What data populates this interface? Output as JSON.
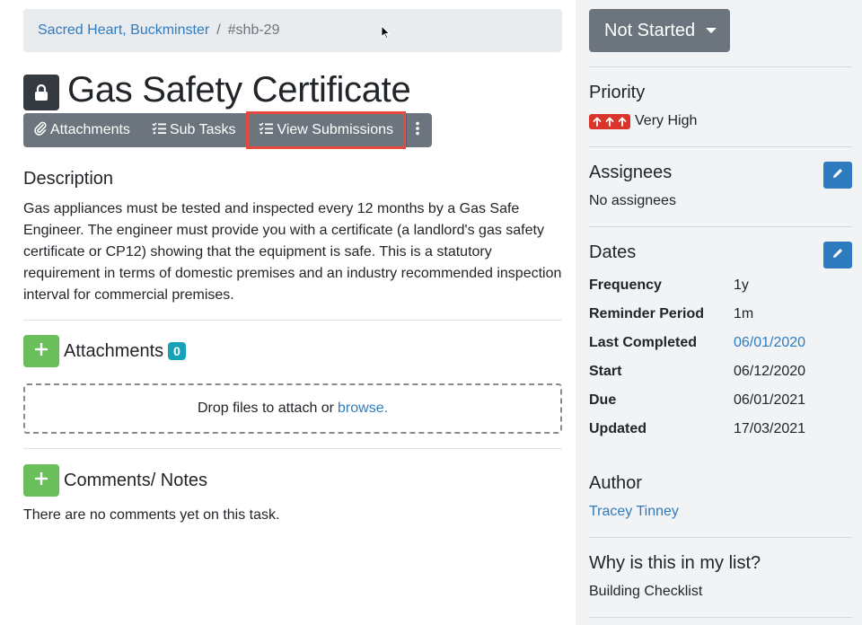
{
  "breadcrumb": {
    "site": "Sacred Heart, Buckminster",
    "separator": "/",
    "ref": "#shb-29"
  },
  "title": "Gas Safety Certificate",
  "toolbar": {
    "attachments_label": "Attachments",
    "subtasks_label": "Sub Tasks",
    "view_submissions_label": "View Submissions"
  },
  "description": {
    "heading": "Description",
    "text": "Gas appliances must be tested and inspected every 12 months by a Gas Safe Engineer. The engineer must provide you with a certificate (a landlord's gas safety certificate or CP12) showing that the equipment is safe. This is a statutory requirement in terms of domestic premises and an industry recommended inspection interval for commercial premises."
  },
  "attachments": {
    "heading": "Attachments",
    "count": "0",
    "drop_text": "Drop files to attach or",
    "browse_link": "browse."
  },
  "comments": {
    "heading": "Comments/ Notes",
    "empty_text": "There are no comments yet on this task."
  },
  "sidebar": {
    "status": "Not Started",
    "priority": {
      "heading": "Priority",
      "value": "Very High",
      "color": "#d9352b"
    },
    "assignees": {
      "heading": "Assignees",
      "value": "No assignees"
    },
    "dates": {
      "heading": "Dates",
      "rows": [
        {
          "label": "Frequency",
          "value": "1y"
        },
        {
          "label": "Reminder Period",
          "value": "1m"
        },
        {
          "label": "Last Completed",
          "value": "06/01/2020"
        },
        {
          "label": "Start",
          "value": "06/12/2020"
        },
        {
          "label": "Due",
          "value": "06/01/2021"
        },
        {
          "label": "Updated",
          "value": "17/03/2021"
        }
      ]
    },
    "author": {
      "heading": "Author",
      "value": "Tracey Tinney"
    },
    "why": {
      "heading": "Why is this in my list?",
      "value": "Building Checklist"
    }
  },
  "colors": {
    "link": "#2f7bbf",
    "secondary": "#6c757d",
    "success": "#6abf5c",
    "info": "#17a2b8",
    "highlight": "#e64a3f"
  },
  "icons": [
    "lock-icon",
    "paperclip-icon",
    "checklist-icon",
    "kebab-icon",
    "plus-icon",
    "pencil-icon",
    "priority-arrows-icon",
    "caret-down-icon"
  ]
}
